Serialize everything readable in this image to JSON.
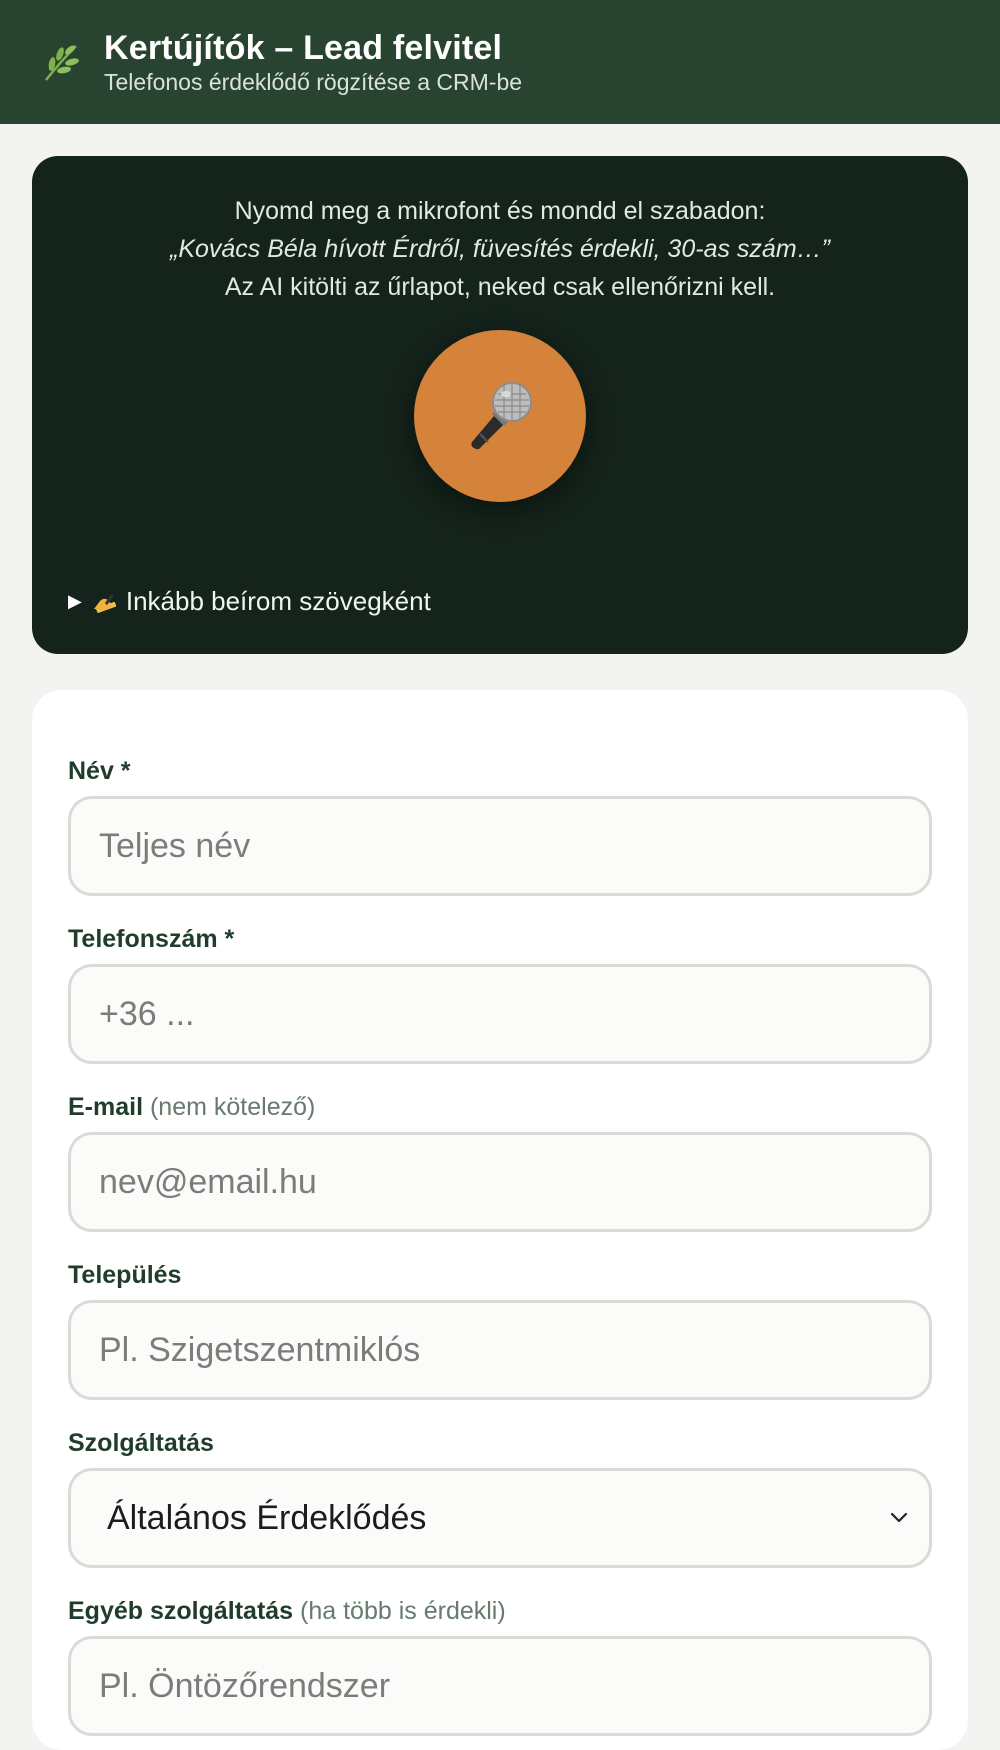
{
  "header": {
    "title": "Kertújítók – Lead felvitel",
    "subtitle": "Telefonos érdeklődő rögzítése a CRM-be",
    "logo_icon": "leaf-icon",
    "background": "#28432f"
  },
  "voice": {
    "instruction": "Nyomd meg a mikrofont és mondd el szabadon:",
    "example": "„Kovács Béla hívott Érdről, füvesítés érdekli, 30-as szám…”",
    "note": "Az AI kitölti az űrlapot, neked csak ellenőrizni kell.",
    "mic_icon": "microphone-icon",
    "mic_color": "#d5823b",
    "toggle_label": "Inkább beírom szövegként"
  },
  "form": {
    "name": {
      "label": "Név *",
      "placeholder": "Teljes név",
      "value": ""
    },
    "phone": {
      "label": "Telefonszám *",
      "placeholder": "+36 ...",
      "value": ""
    },
    "email": {
      "label": "E-mail",
      "hint": "(nem kötelező)",
      "placeholder": "nev@email.hu",
      "value": ""
    },
    "city": {
      "label": "Település",
      "placeholder": "Pl. Szigetszentmiklós",
      "value": ""
    },
    "service": {
      "label": "Szolgáltatás",
      "selected": "Általános Érdeklődés"
    },
    "other_service": {
      "label": "Egyéb szolgáltatás",
      "hint": "(ha több is érdekli)",
      "placeholder": "Pl. Öntözőrendszer",
      "value": ""
    }
  }
}
